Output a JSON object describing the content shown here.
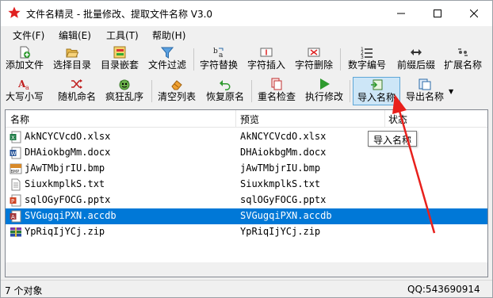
{
  "window": {
    "title": "文件名精灵 - 批量修改、提取文件名称  V3.0"
  },
  "menu": {
    "items": [
      "文件(F)",
      "编辑(E)",
      "工具(T)",
      "帮助(H)"
    ]
  },
  "toolbar1": {
    "items": [
      "添加文件",
      "选择目录",
      "目录嵌套",
      "文件过滤",
      "字符替换",
      "字符插入",
      "字符删除",
      "数字编号",
      "前缀后缀",
      "扩展名称"
    ]
  },
  "toolbar2": {
    "items": [
      "大写小写",
      "随机命名",
      "疯狂乱序",
      "清空列表",
      "恢复原名",
      "重名检查",
      "执行修改",
      "导入名称",
      "导出名称"
    ],
    "pressed": "导入名称"
  },
  "list": {
    "columns": [
      "名称",
      "预览",
      "状态"
    ],
    "rows": [
      {
        "name": "AkNCYCVcdO.xlsx",
        "preview": "AkNCYCVcdO.xlsx",
        "type": "xlsx"
      },
      {
        "name": "DHAiokbgMm.docx",
        "preview": "DHAiokbgMm.docx",
        "type": "docx"
      },
      {
        "name": "jAwTMbjrIU.bmp",
        "preview": "jAwTMbjrIU.bmp",
        "type": "bmp"
      },
      {
        "name": "SiuxkmplkS.txt",
        "preview": "SiuxkmplkS.txt",
        "type": "txt"
      },
      {
        "name": "sqlOGyFOCG.pptx",
        "preview": "sqlOGyFOCG.pptx",
        "type": "pptx"
      },
      {
        "name": "SVGugqiPXN.accdb",
        "preview": "SVGugqiPXN.accdb",
        "type": "accdb",
        "selected": true
      },
      {
        "name": "YpRiqIjYCj.zip",
        "preview": "YpRiqIjYCj.zip",
        "type": "zip"
      }
    ]
  },
  "tooltip": "导入名称",
  "status": {
    "count": "7 个对象",
    "qq": "QQ:543690914"
  },
  "colors": {
    "selection": "#0078d7",
    "annotation_arrow": "#e8201c",
    "pressed_bg": "#cde6f7"
  }
}
